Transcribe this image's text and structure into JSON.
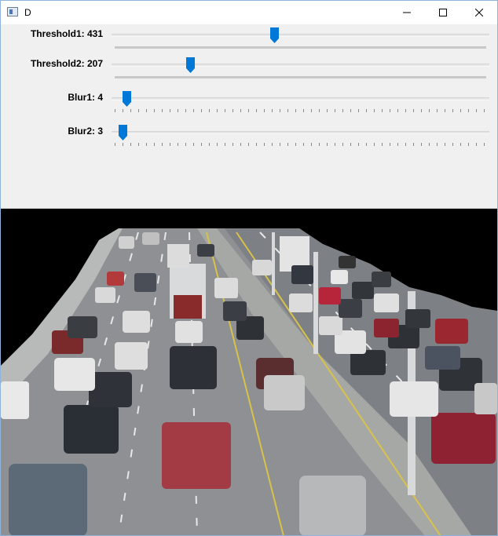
{
  "window": {
    "title": "D",
    "minimize_icon": "minimize-icon",
    "maximize_icon": "maximize-icon",
    "close_icon": "close-icon"
  },
  "trackbars": [
    {
      "label": "Threshold1: 431",
      "value": 431,
      "max": 1000
    },
    {
      "label": "Threshold2: 207",
      "value": 207,
      "max": 1000
    },
    {
      "label": "Blur1: 4",
      "value": 4,
      "max": 100
    },
    {
      "label": "Blur2: 3",
      "value": 3,
      "max": 100
    }
  ],
  "colors": {
    "thumb": "#0078d7",
    "image_background": "#000000"
  }
}
